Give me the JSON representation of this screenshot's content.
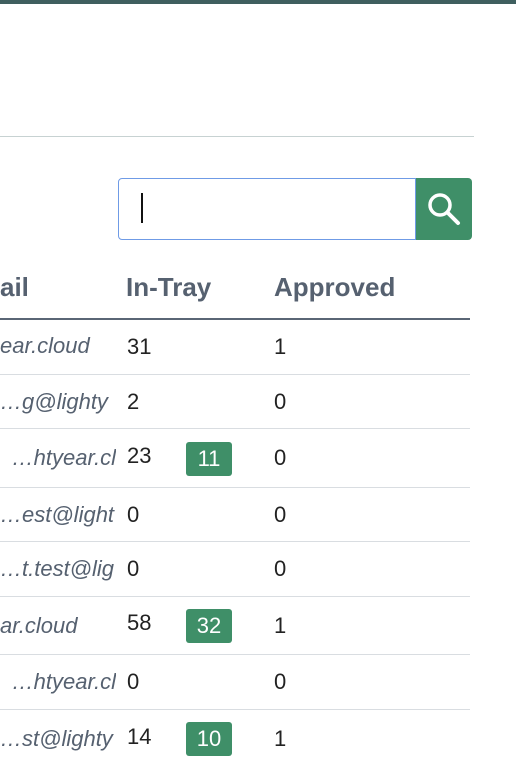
{
  "search": {
    "value": "",
    "placeholder": ""
  },
  "table": {
    "headers": {
      "email": "ail",
      "in_tray": "In-Tray",
      "approved": "Approved"
    },
    "rows": [
      {
        "email": "ear.cloud",
        "in_tray": "31",
        "badge": "",
        "approved": "1"
      },
      {
        "email": "g@lighty…",
        "in_tray": "2",
        "badge": "",
        "approved": "0"
      },
      {
        "email": "ghtyear.cl…",
        "in_tray": "23",
        "badge": "11",
        "approved": "0"
      },
      {
        "email": "est@light…",
        "in_tray": "0",
        "badge": "",
        "approved": "0"
      },
      {
        "email": "t.test@lig…",
        "in_tray": "0",
        "badge": "",
        "approved": "0"
      },
      {
        "email": "ar.cloud",
        "in_tray": "58",
        "badge": "32",
        "approved": "1"
      },
      {
        "email": "ghtyear.cl…",
        "in_tray": "0",
        "badge": "",
        "approved": "0"
      },
      {
        "email": "st@lighty…",
        "in_tray": "14",
        "badge": "10",
        "approved": "1"
      }
    ]
  },
  "colors": {
    "accent_green": "#3f8f68",
    "header_text": "#566170",
    "search_border": "#6f9be6"
  },
  "icons": {
    "search_button_icon": "search-icon"
  }
}
